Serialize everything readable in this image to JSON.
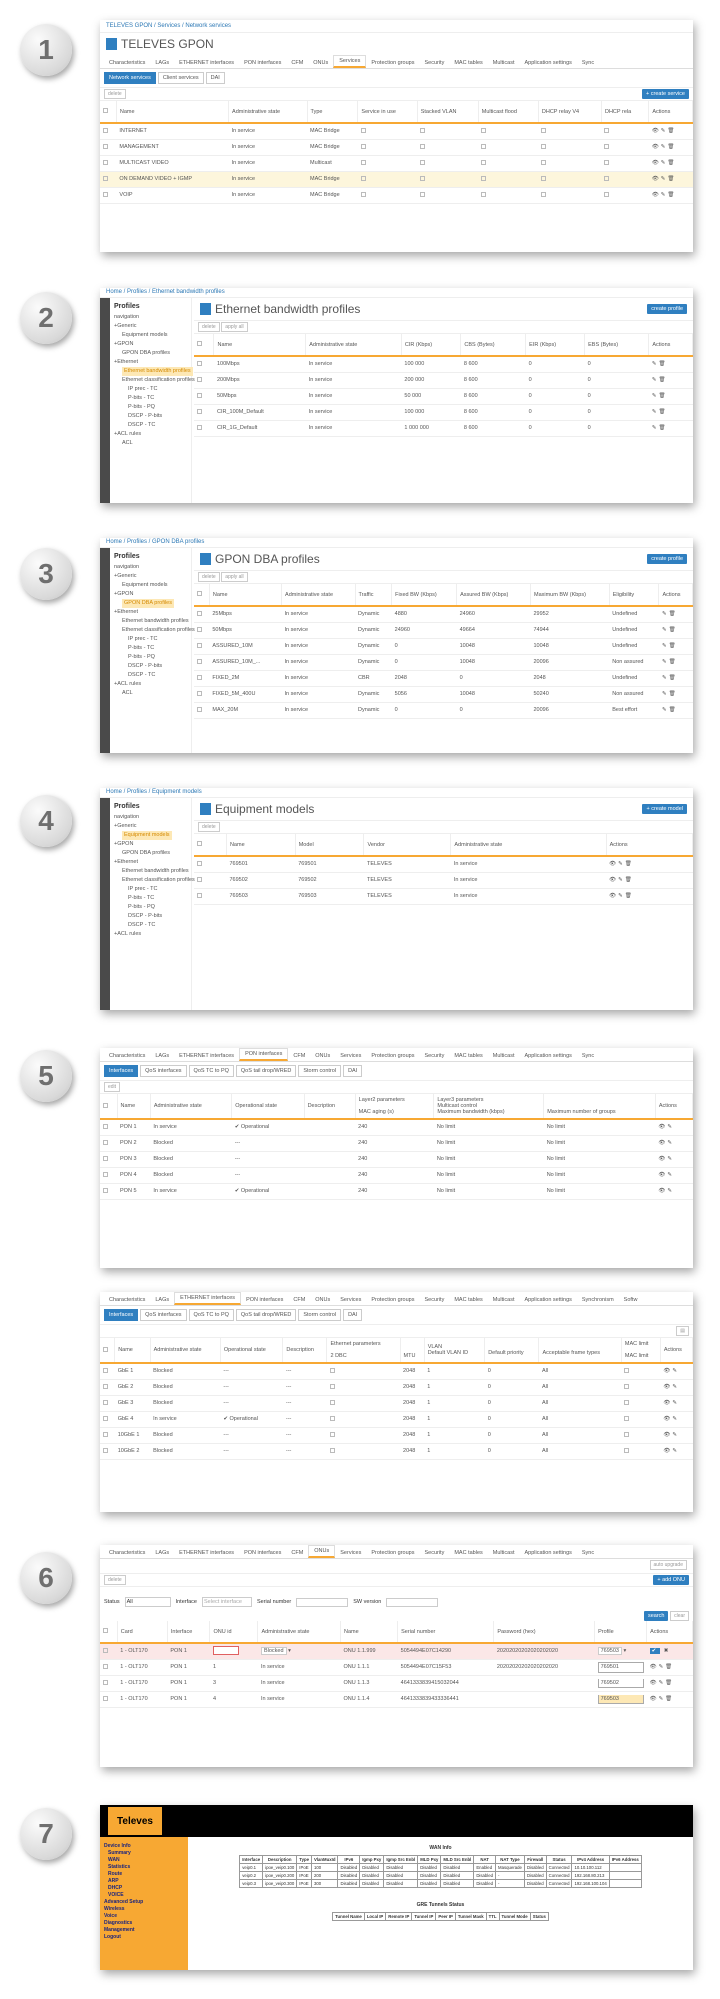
{
  "steps": [
    "1",
    "2",
    "3",
    "4",
    "5",
    "6",
    "7"
  ],
  "s1": {
    "crumb": "TELEVES GPON / Services / Network services",
    "title": "TELEVES GPON",
    "tabs": [
      "Characteristics",
      "LAGs",
      "ETHERNET interfaces",
      "PON interfaces",
      "CFM",
      "ONUs",
      "Services",
      "Protection groups",
      "Security",
      "MAC tables",
      "Multicast",
      "Application settings",
      "Sync"
    ],
    "subtabs": [
      "Network services",
      "Client services",
      "DAI"
    ],
    "delete": "delete",
    "create": "+ create service",
    "cols": [
      "Name",
      "Administrative state",
      "Type",
      "Service in use",
      "Stacked VLAN",
      "Multicast flood",
      "DHCP relay V4",
      "DHCP rela",
      "Actions"
    ],
    "rows": [
      [
        "INTERNET",
        "In service",
        "MAC Bridge"
      ],
      [
        "MANAGEMENT",
        "In service",
        "MAC Bridge"
      ],
      [
        "MULTICAST VIDEO",
        "In service",
        "Multicast"
      ],
      [
        "ON DEMAND VIDEO + IGMP",
        "In service",
        "MAC Bridge"
      ],
      [
        "VOIP",
        "In service",
        "MAC Bridge"
      ]
    ]
  },
  "tree2": {
    "head": "Profiles",
    "nav": "navigation",
    "items": [
      "Generic",
      "Equipment models",
      "GPON",
      "GPON DBA profiles",
      "Ethernet",
      "Ethernet bandwidth profiles",
      "Ethernet classification profiles",
      "IP prec - TC",
      "P-bits - TC",
      "P-bits - PQ",
      "DSCP - P-bits",
      "DSCP - TC",
      "ACL rules",
      "ACL"
    ]
  },
  "s2": {
    "crumb": "Home / Profiles / Ethernet bandwidth profiles",
    "title": "Ethernet bandwidth profiles",
    "create": "create profile",
    "delete": "delete",
    "apply": "apply all",
    "cols": [
      "Name",
      "Administrative state",
      "CIR (Kbps)",
      "CBS (Bytes)",
      "EIR (Kbps)",
      "EBS (Bytes)",
      "Actions"
    ],
    "rows": [
      [
        "100Mbps",
        "In service",
        "100 000",
        "8 600",
        "0",
        "0"
      ],
      [
        "200Mbps",
        "In service",
        "200 000",
        "8 600",
        "0",
        "0"
      ],
      [
        "50Mbps",
        "In service",
        "50 000",
        "8 600",
        "0",
        "0"
      ],
      [
        "CIR_100M_Default",
        "In service",
        "100 000",
        "8 600",
        "0",
        "0"
      ],
      [
        "CIR_1G_Default",
        "In service",
        "1 000 000",
        "8 600",
        "0",
        "0"
      ]
    ]
  },
  "s3": {
    "crumb": "Home / Profiles / GPON DBA profiles",
    "title": "GPON DBA profiles",
    "create": "create profile",
    "delete": "delete",
    "apply": "apply all",
    "cols": [
      "Name",
      "Administrative state",
      "Traffic",
      "Fixed BW (Kbps)",
      "Assured BW (Kbps)",
      "Maximum BW (Kbps)",
      "Eligibility",
      "Actions"
    ],
    "rows": [
      [
        "25Mbps",
        "In service",
        "Dynamic",
        "4880",
        "24960",
        "29952",
        "Undefined"
      ],
      [
        "50Mbps",
        "In service",
        "Dynamic",
        "24960",
        "49664",
        "74944",
        "Undefined"
      ],
      [
        "ASSURED_10M",
        "In service",
        "Dynamic",
        "0",
        "10048",
        "10048",
        "Undefined"
      ],
      [
        "ASSURED_10M_...",
        "In service",
        "Dynamic",
        "0",
        "10048",
        "20096",
        "Non assured"
      ],
      [
        "FIXED_2M",
        "In service",
        "CBR",
        "2048",
        "0",
        "2048",
        "Undefined"
      ],
      [
        "FIXED_5M_400U",
        "In service",
        "Dynamic",
        "5056",
        "10048",
        "50240",
        "Non assured"
      ],
      [
        "MAX_20M",
        "In service",
        "Dynamic",
        "0",
        "0",
        "20096",
        "Best effort"
      ]
    ]
  },
  "s4": {
    "crumb": "Home / Profiles / Equipment models",
    "title": "Equipment models",
    "create": "+ create model",
    "delete": "delete",
    "cols": [
      "Name",
      "Model",
      "Vendor",
      "Administrative state",
      "Actions"
    ],
    "rows": [
      [
        "769501",
        "769501",
        "TELEVES",
        "In service"
      ],
      [
        "769502",
        "769502",
        "TELEVES",
        "In service"
      ],
      [
        "769503",
        "769503",
        "TELEVES",
        "In service"
      ]
    ]
  },
  "s5": {
    "tabs": [
      "Characteristics",
      "LAGs",
      "ETHERNET interfaces",
      "PON interfaces",
      "CFM",
      "ONUs",
      "Services",
      "Protection groups",
      "Security",
      "MAC tables",
      "Multicast",
      "Application settings",
      "Sync"
    ],
    "subtabs": [
      "Interfaces",
      "QoS interfaces",
      "QoS TC to PQ",
      "QoS tail drop/WRED",
      "Storm control",
      "DAI"
    ],
    "edit": "edit",
    "cols": [
      "Name",
      "Administrative state",
      "Operational state",
      "Description",
      "Layer2 parameters",
      "Layer3 parameters",
      "Actions"
    ],
    "subcols": [
      "MAC aging (s)",
      "Multicast control",
      "Maximum bandwidth (kbps)",
      "Maximum number of groups"
    ],
    "rows": [
      [
        "PON 1",
        "In service",
        "Operational",
        "240",
        "No limit",
        "No limit"
      ],
      [
        "PON 2",
        "Blocked",
        "---",
        "240",
        "No limit",
        "No limit"
      ],
      [
        "PON 3",
        "Blocked",
        "---",
        "240",
        "No limit",
        "No limit"
      ],
      [
        "PON 4",
        "Blocked",
        "---",
        "240",
        "No limit",
        "No limit"
      ],
      [
        "PON 5",
        "In service",
        "Operational",
        "240",
        "No limit",
        "No limit"
      ]
    ]
  },
  "s5b": {
    "tabs": [
      "Characteristics",
      "LAGs",
      "ETHERNET interfaces",
      "PON interfaces",
      "CFM",
      "ONUs",
      "Services",
      "Protection groups",
      "Security",
      "MAC tables",
      "Multicast",
      "Application settings",
      "Synchronism",
      "Softw"
    ],
    "subtabs": [
      "Interfaces",
      "QoS interfaces",
      "QoS TC to PQ",
      "QoS tail drop/WRED",
      "Storm control",
      "DAI"
    ],
    "cols": [
      "Name",
      "Administrative state",
      "Operational state",
      "Description",
      "Ethernet parameters",
      "VLAN",
      "MAC limit",
      "Actions"
    ],
    "subcols": [
      "2 DBC",
      "MTU",
      "Default VLAN ID",
      "Default priority",
      "Acceptable frame types",
      "MAC limit"
    ],
    "rows": [
      [
        "GbE 1",
        "Blocked",
        "---",
        "---",
        "2048",
        "1",
        "0",
        "All"
      ],
      [
        "GbE 2",
        "Blocked",
        "---",
        "---",
        "2048",
        "1",
        "0",
        "All"
      ],
      [
        "GbE 3",
        "Blocked",
        "---",
        "---",
        "2048",
        "1",
        "0",
        "All"
      ],
      [
        "GbE 4",
        "In service",
        "Operational",
        "---",
        "2048",
        "1",
        "0",
        "All"
      ],
      [
        "10GbE 1",
        "Blocked",
        "---",
        "---",
        "2048",
        "1",
        "0",
        "All"
      ],
      [
        "10GbE 2",
        "Blocked",
        "---",
        "---",
        "2048",
        "1",
        "0",
        "All"
      ]
    ]
  },
  "s6": {
    "tabs": [
      "Characteristics",
      "LAGs",
      "ETHERNET interfaces",
      "PON interfaces",
      "CFM",
      "ONUs",
      "Services",
      "Protection groups",
      "Security",
      "MAC tables",
      "Multicast",
      "Application settings",
      "Sync"
    ],
    "autoupgrade": "auto upgrade",
    "delete": "delete",
    "add": "+ add ONU",
    "filters": {
      "status": "Status",
      "status_val": "All",
      "iface": "Interface",
      "iface_ph": "Select interface",
      "serial": "Serial number",
      "sw": "SW version",
      "search": "search",
      "clear": "clear"
    },
    "cols": [
      "Card",
      "Interface",
      "ONU id",
      "Administrative state",
      "Name",
      "Serial number",
      "Password (hex)",
      "Profile",
      "Actions"
    ],
    "rows": [
      [
        "1 - OLT170",
        "PON 1",
        "",
        "Blocked",
        "ONU 1.1.999",
        "5054494E07C14290",
        "20202020202020202020",
        "769503"
      ],
      [
        "1 - OLT170",
        "PON 1",
        "1",
        "In service",
        "ONU 1.1.1",
        "5054494E07C15F53",
        "20202020202020202020",
        ""
      ],
      [
        "1 - OLT170",
        "PON 1",
        "3",
        "In service",
        "ONU 1.1.3",
        "4641333839415032044",
        "",
        ""
      ],
      [
        "1 - OLT170",
        "PON 1",
        "4",
        "In service",
        "ONU 1.1.4",
        "4641333839433336441",
        "",
        ""
      ]
    ],
    "dropdown": [
      "769501",
      "769502",
      "769503"
    ]
  },
  "s7": {
    "logo": "Televes",
    "title": "WAN Info",
    "menu": [
      "Device Info",
      "Summary",
      "WAN",
      "Statistics",
      "Route",
      "ARP",
      "DHCP",
      "VOICE",
      "Advanced Setup",
      "Wireless",
      "Voice",
      "Diagnostics",
      "Management",
      "Logout"
    ],
    "cols": [
      "Interface",
      "Description",
      "Type",
      "VlanMuxId",
      "IPv6",
      "Igmp Pxy",
      "Igmp Src Enbl",
      "MLD Pxy",
      "MLD Src Enbl",
      "NAT",
      "NAT Type",
      "Firewall",
      "Status",
      "IPv4 Address",
      "IPv6 Address"
    ],
    "rows": [
      [
        "veip0.1",
        "ipoe_veip0.100",
        "IPoE",
        "100",
        "Disabled",
        "Disabled",
        "Disabled",
        "Disabled",
        "Disabled",
        "Enabled",
        "Masquerade",
        "Disabled",
        "Connected",
        "10.10.100.112",
        ""
      ],
      [
        "veip0.2",
        "ipoe_veip0.200",
        "IPoE",
        "200",
        "Disabled",
        "Disabled",
        "Disabled",
        "Disabled",
        "Disabled",
        "Disabled",
        "-",
        "Disabled",
        "Connected",
        "192.168.80.213",
        ""
      ],
      [
        "veip0.3",
        "ipoe_veip0.300",
        "IPoE",
        "300",
        "Disabled",
        "Disabled",
        "Disabled",
        "Disabled",
        "Disabled",
        "Disabled",
        "-",
        "Disabled",
        "Connected",
        "192.168.100.104",
        ""
      ]
    ],
    "gre_title": "GRE Tunnels Status",
    "gre_cols": [
      "Tunnel Name",
      "Local IP",
      "Remote IP",
      "Tunnel IP",
      "Peer IP",
      "Tunnel Mask",
      "TTL",
      "Tunnel Mode",
      "Status"
    ]
  }
}
